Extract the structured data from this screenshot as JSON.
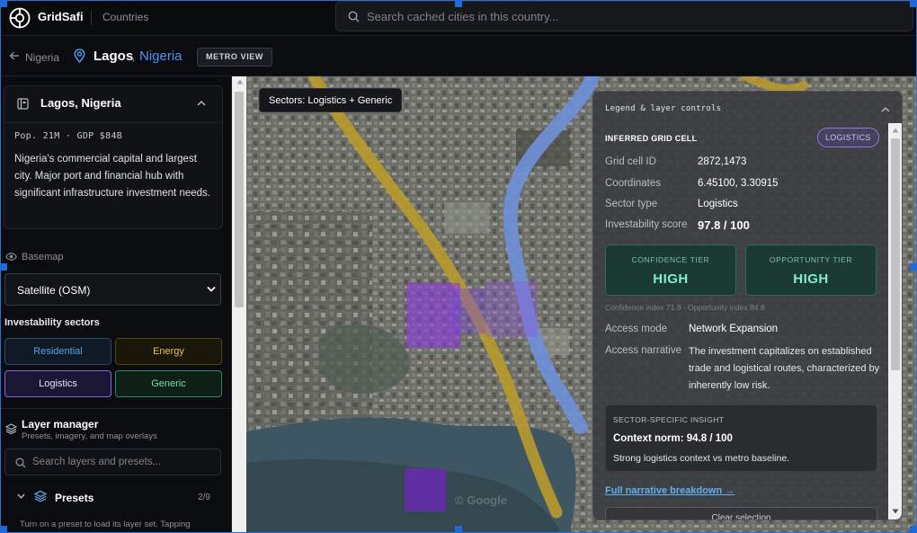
{
  "header": {
    "brand": "GridSafi",
    "nav_link": "Countries",
    "search_placeholder": "Search cached cities in this country..."
  },
  "breadcrumb": {
    "parent": "Nigeria",
    "city": "Lagos",
    "separator": ",",
    "country": "Nigeria",
    "badge": "METRO VIEW"
  },
  "sidebar": {
    "city_card": {
      "title": "Lagos, Nigeria",
      "stats": "Pop. 21M · GDP $84B",
      "description": "Nigeria's commercial capital and largest city. Major port and financial hub with significant infrastructure investment needs."
    },
    "basemap": {
      "label": "Basemap",
      "selected": "Satellite (OSM)"
    },
    "sectors": {
      "title": "Investability sectors",
      "items": [
        {
          "label": "Residential",
          "color": "#5aa2e6",
          "active": false
        },
        {
          "label": "Energy",
          "color": "#e3c55a",
          "active": false
        },
        {
          "label": "Logistics",
          "color": "#7b6cd6",
          "active": true
        },
        {
          "label": "Generic",
          "color": "#76e0aa",
          "active": true
        }
      ]
    },
    "layer_manager": {
      "title": "Layer manager",
      "subtitle": "Presets, imagery, and map overlays",
      "search_placeholder": "Search layers and presets...",
      "presets_title": "Presets",
      "presets_count": "2/9",
      "presets_hint": "Turn on a preset to load its layer set. Tapping"
    }
  },
  "map": {
    "sector_chip": "Sectors: Logistics + Generic",
    "watermark": "© Google"
  },
  "legend": {
    "title": "Legend & layer controls",
    "cell_heading": "INFERRED GRID CELL",
    "cell_badge": "LOGISTICS",
    "rows": [
      {
        "key": "Grid cell ID",
        "value": "2872,1473"
      },
      {
        "key": "Coordinates",
        "value": "6.45100, 3.30915"
      },
      {
        "key": "Sector type",
        "value": "Logistics"
      },
      {
        "key": "Investability score",
        "value": "97.8 / 100"
      }
    ],
    "confidence_label": "CONFIDENCE TIER",
    "confidence_value": "HIGH",
    "opportunity_label": "OPPORTUNITY TIER",
    "opportunity_value": "HIGH",
    "tier_meta": "Confidence index 71.8 · Opportunity index 84.8",
    "access_mode_key": "Access mode",
    "access_mode_value": "Network Expansion",
    "access_narrative_key": "Access narrative",
    "access_narrative_value": "The investment capitalizes on established trade and logistical routes, characterized by inherently low risk.",
    "insight_heading": "SECTOR-SPECIFIC INSIGHT",
    "insight_norm": "Context norm: 94.8 / 100",
    "insight_desc": "Strong logistics context vs metro baseline.",
    "link": "Full narrative breakdown →",
    "clear_button": "Clear selection"
  },
  "colors": {
    "accent_blue": "#4f95f0",
    "logistics_purple": "#7b6cd6",
    "tier_green": "#7ff0c8",
    "road_yellow": "#b99a2c",
    "route_blue": "#6f8fd8"
  }
}
